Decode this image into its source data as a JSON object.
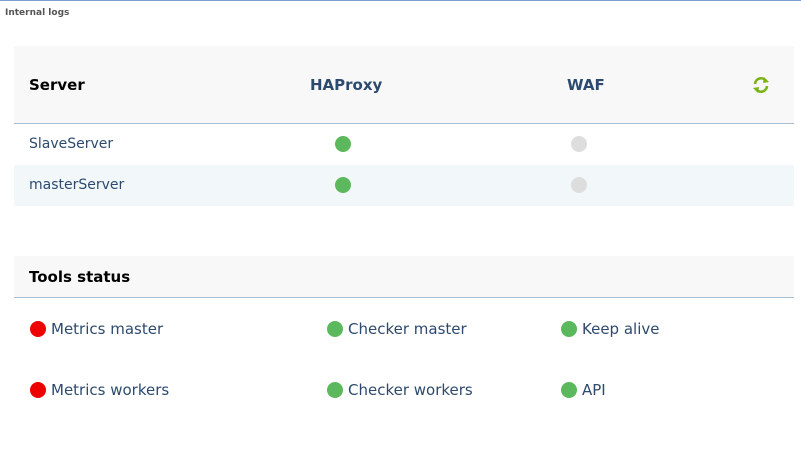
{
  "panel": {
    "title": "Internal logs"
  },
  "servers": {
    "headers": {
      "server": "Server",
      "haproxy": "HAProxy",
      "waf": "WAF"
    },
    "refresh_icon": "refresh-icon",
    "rows": [
      {
        "name": "SlaveServer",
        "haproxy": "active",
        "waf": "inactive"
      },
      {
        "name": "masterServer",
        "haproxy": "active",
        "waf": "inactive"
      }
    ]
  },
  "tools": {
    "title": "Tools status",
    "items": [
      {
        "label": "Metrics master",
        "status": "error"
      },
      {
        "label": "Checker master",
        "status": "active"
      },
      {
        "label": "Keep alive",
        "status": "active"
      },
      {
        "label": "Metrics workers",
        "status": "error"
      },
      {
        "label": "Checker workers",
        "status": "active"
      },
      {
        "label": "API",
        "status": "active"
      }
    ]
  },
  "colors": {
    "active": "#5cb85c",
    "inactive": "#dddddd",
    "error": "#ee0000",
    "link": "#2d4a6e",
    "header_rule": "#a9bfd6",
    "refresh": "#7ab317"
  }
}
